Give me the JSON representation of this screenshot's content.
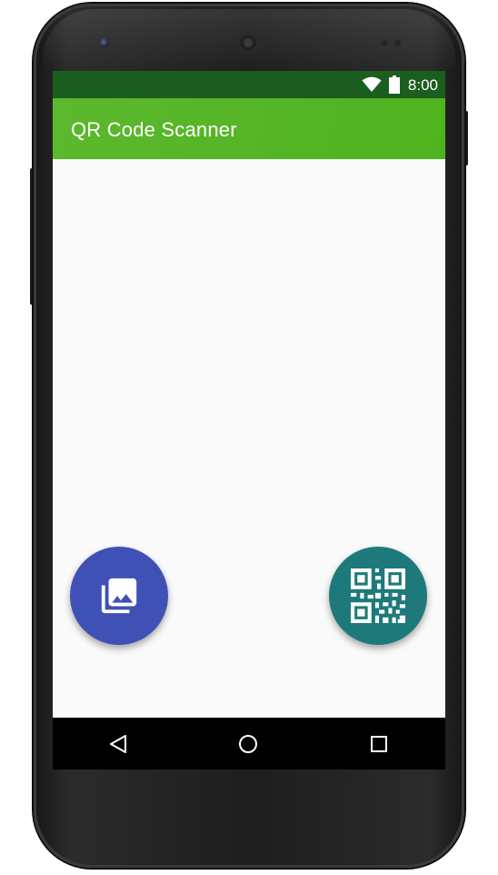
{
  "status_bar": {
    "time": "8:00",
    "icons": [
      "wifi-icon",
      "battery-icon"
    ],
    "color": "#1b5e20"
  },
  "toolbar": {
    "title": "QR Code Scanner",
    "color": "#4caf1f"
  },
  "fabs": [
    {
      "name": "gallery-button",
      "icon": "photo-library-icon",
      "color": "#3f51b5"
    },
    {
      "name": "scan-qr-button",
      "icon": "qr-code-icon",
      "color": "#1e7a7a"
    }
  ],
  "nav_bar": {
    "buttons": [
      "back-icon",
      "home-icon",
      "recents-icon"
    ]
  }
}
